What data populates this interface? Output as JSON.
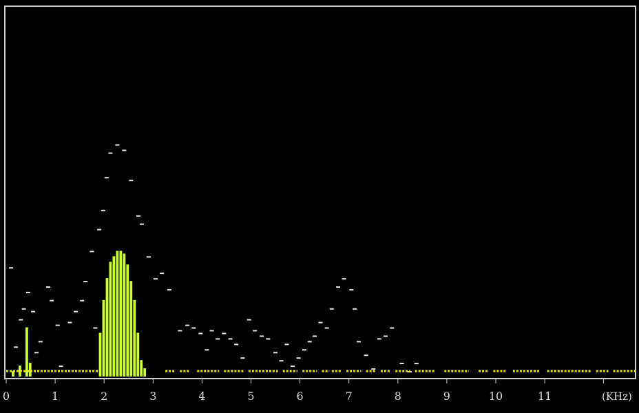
{
  "chart_data": {
    "type": "bar",
    "title": "",
    "xlabel": "(KHz)",
    "ylabel": "",
    "xlim": [
      0,
      12.85
    ],
    "ylim": [
      0,
      1
    ],
    "grid": false,
    "legend": "none",
    "x_ticks": [
      0,
      1,
      2,
      3,
      4,
      5,
      6,
      7,
      8,
      9,
      10,
      11
    ],
    "x_tick_labels": [
      "0",
      "1",
      "2",
      "3",
      "4",
      "5",
      "6",
      "7",
      "8",
      "9",
      "10",
      "11"
    ],
    "bin_width_khz": 0.0703,
    "baseline_value": 0.02,
    "level_bars": [
      {
        "x": 0.14,
        "value": 0.02
      },
      {
        "x": 0.28,
        "value": 0.04
      },
      {
        "x": 0.42,
        "value": 0.18
      },
      {
        "x": 0.49,
        "value": 0.05
      },
      {
        "x": 1.92,
        "value": 0.16
      },
      {
        "x": 1.99,
        "value": 0.28
      },
      {
        "x": 2.06,
        "value": 0.36
      },
      {
        "x": 2.13,
        "value": 0.42
      },
      {
        "x": 2.2,
        "value": 0.44
      },
      {
        "x": 2.27,
        "value": 0.46
      },
      {
        "x": 2.34,
        "value": 0.46
      },
      {
        "x": 2.41,
        "value": 0.45
      },
      {
        "x": 2.48,
        "value": 0.41
      },
      {
        "x": 2.55,
        "value": 0.35
      },
      {
        "x": 2.62,
        "value": 0.28
      },
      {
        "x": 2.69,
        "value": 0.16
      },
      {
        "x": 2.76,
        "value": 0.06
      },
      {
        "x": 2.83,
        "value": 0.03
      }
    ],
    "baseline_segments": [
      [
        0.0,
        1.9
      ],
      [
        3.25,
        3.45
      ],
      [
        3.55,
        3.75
      ],
      [
        3.9,
        4.35
      ],
      [
        4.45,
        4.85
      ],
      [
        4.95,
        5.55
      ],
      [
        5.65,
        5.95
      ],
      [
        6.05,
        6.35
      ],
      [
        6.45,
        6.6
      ],
      [
        6.65,
        6.85
      ],
      [
        6.95,
        7.25
      ],
      [
        7.35,
        7.55
      ],
      [
        7.65,
        7.85
      ],
      [
        7.95,
        8.25
      ],
      [
        8.35,
        8.75
      ],
      [
        8.95,
        9.45
      ],
      [
        9.65,
        9.85
      ],
      [
        9.95,
        10.2
      ],
      [
        10.35,
        10.9
      ],
      [
        11.05,
        11.95
      ],
      [
        12.05,
        12.3
      ],
      [
        12.4,
        12.85
      ]
    ],
    "peak_hold": [
      {
        "x": 0.1,
        "value": 0.4
      },
      {
        "x": 0.2,
        "value": 0.11
      },
      {
        "x": 0.3,
        "value": 0.21
      },
      {
        "x": 0.36,
        "value": 0.25
      },
      {
        "x": 0.45,
        "value": 0.31
      },
      {
        "x": 0.55,
        "value": 0.24
      },
      {
        "x": 0.62,
        "value": 0.09
      },
      {
        "x": 0.7,
        "value": 0.13
      },
      {
        "x": 0.86,
        "value": 0.33
      },
      {
        "x": 0.93,
        "value": 0.28
      },
      {
        "x": 1.05,
        "value": 0.19
      },
      {
        "x": 1.12,
        "value": 0.04
      },
      {
        "x": 1.3,
        "value": 0.2
      },
      {
        "x": 1.42,
        "value": 0.24
      },
      {
        "x": 1.55,
        "value": 0.28
      },
      {
        "x": 1.62,
        "value": 0.35
      },
      {
        "x": 1.75,
        "value": 0.46
      },
      {
        "x": 1.82,
        "value": 0.18
      },
      {
        "x": 1.9,
        "value": 0.54
      },
      {
        "x": 1.98,
        "value": 0.61
      },
      {
        "x": 2.05,
        "value": 0.73
      },
      {
        "x": 2.13,
        "value": 0.82
      },
      {
        "x": 2.27,
        "value": 0.85
      },
      {
        "x": 2.41,
        "value": 0.83
      },
      {
        "x": 2.55,
        "value": 0.72
      },
      {
        "x": 2.7,
        "value": 0.59
      },
      {
        "x": 2.77,
        "value": 0.56
      },
      {
        "x": 2.91,
        "value": 0.44
      },
      {
        "x": 3.05,
        "value": 0.36
      },
      {
        "x": 3.18,
        "value": 0.38
      },
      {
        "x": 3.33,
        "value": 0.32
      },
      {
        "x": 3.55,
        "value": 0.17
      },
      {
        "x": 3.7,
        "value": 0.19
      },
      {
        "x": 3.83,
        "value": 0.18
      },
      {
        "x": 3.97,
        "value": 0.16
      },
      {
        "x": 4.1,
        "value": 0.1
      },
      {
        "x": 4.2,
        "value": 0.17
      },
      {
        "x": 4.32,
        "value": 0.14
      },
      {
        "x": 4.45,
        "value": 0.16
      },
      {
        "x": 4.58,
        "value": 0.14
      },
      {
        "x": 4.7,
        "value": 0.12
      },
      {
        "x": 4.83,
        "value": 0.07
      },
      {
        "x": 4.96,
        "value": 0.21
      },
      {
        "x": 5.08,
        "value": 0.17
      },
      {
        "x": 5.22,
        "value": 0.15
      },
      {
        "x": 5.35,
        "value": 0.14
      },
      {
        "x": 5.5,
        "value": 0.09
      },
      {
        "x": 5.62,
        "value": 0.06
      },
      {
        "x": 5.73,
        "value": 0.12
      },
      {
        "x": 5.85,
        "value": 0.04
      },
      {
        "x": 5.97,
        "value": 0.07
      },
      {
        "x": 6.09,
        "value": 0.1
      },
      {
        "x": 6.2,
        "value": 0.13
      },
      {
        "x": 6.3,
        "value": 0.15
      },
      {
        "x": 6.42,
        "value": 0.2
      },
      {
        "x": 6.55,
        "value": 0.18
      },
      {
        "x": 6.65,
        "value": 0.25
      },
      {
        "x": 6.78,
        "value": 0.33
      },
      {
        "x": 6.9,
        "value": 0.36
      },
      {
        "x": 7.05,
        "value": 0.32
      },
      {
        "x": 7.12,
        "value": 0.25
      },
      {
        "x": 7.2,
        "value": 0.13
      },
      {
        "x": 7.35,
        "value": 0.08
      },
      {
        "x": 7.5,
        "value": 0.03
      },
      {
        "x": 7.62,
        "value": 0.14
      },
      {
        "x": 7.75,
        "value": 0.15
      },
      {
        "x": 7.88,
        "value": 0.18
      },
      {
        "x": 8.08,
        "value": 0.05
      },
      {
        "x": 8.24,
        "value": 0.02
      },
      {
        "x": 8.38,
        "value": 0.05
      }
    ],
    "peak_hold_color": "#e8e8e8",
    "bar_color": "#ccff33",
    "baseline_color": "#e8e810",
    "frame_color": "#d0d0d0",
    "background_color": "#000000"
  }
}
